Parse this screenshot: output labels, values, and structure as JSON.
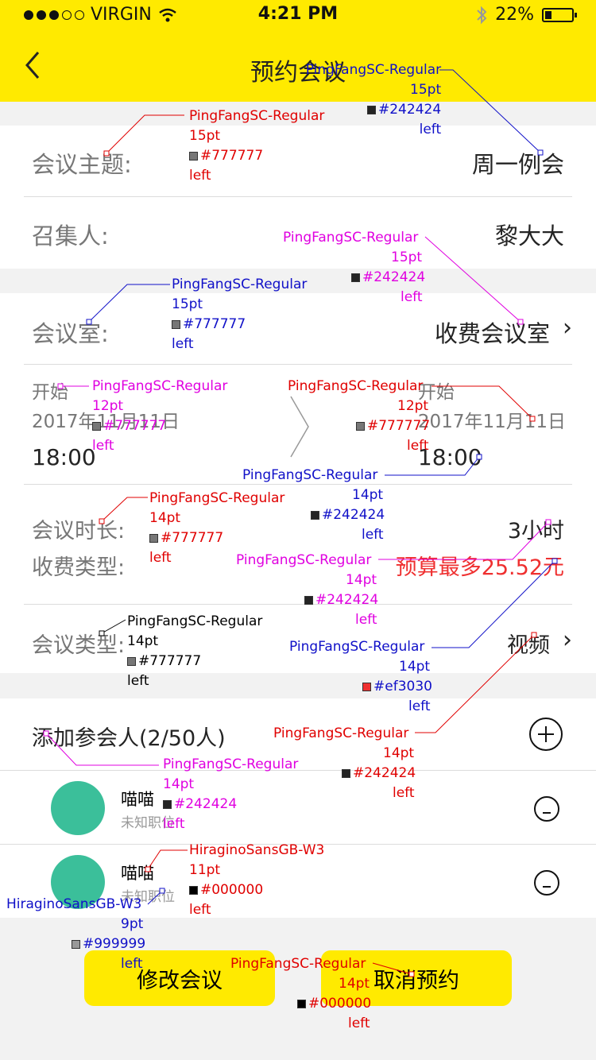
{
  "status": {
    "carrier": "VIRGIN",
    "time": "4:21 PM",
    "battery": "22%"
  },
  "nav": {
    "title": "预约会议"
  },
  "form": {
    "topic_label": "会议主题:",
    "topic_value": "周一例会",
    "organizer_label": "召集人:",
    "organizer_value": "黎大大",
    "room_label": "会议室:",
    "room_value": "收费会议室",
    "start_label": "开始",
    "start_date": "2017年11月11日",
    "start_time": "18:00",
    "end_label": "开始",
    "end_date": "2017年11月11日",
    "end_time": "18:00",
    "duration_label": "会议时长:",
    "duration_value": "3小时",
    "fee_label": "收费类型:",
    "fee_value": "预算最多25.52元",
    "type_label": "会议类型:",
    "type_value": "视频"
  },
  "participants": {
    "title": "添加参会人(2/50人)",
    "items": [
      {
        "name": "喵喵",
        "position": "未知职位"
      },
      {
        "name": "喵喵",
        "position": "未知职位"
      }
    ]
  },
  "buttons": {
    "modify": "修改会议",
    "cancel": "取消预约"
  },
  "colors": {
    "accent": "#ffea00",
    "label": "#777777",
    "text": "#242424",
    "red": "#ef3030",
    "avatar": "#3bbf9a"
  },
  "annotations": {
    "a1": {
      "font": "PingFangSC-Regular",
      "size": "15pt",
      "color": "#242424",
      "align": "left"
    },
    "a2": {
      "font": "PingFangSC-Regular",
      "size": "15pt",
      "color": "#777777",
      "align": "left"
    },
    "a3": {
      "font": "PingFangSC-Regular",
      "size": "15pt",
      "color": "#242424",
      "align": "left"
    },
    "a4": {
      "font": "PingFangSC-Regular",
      "size": "15pt",
      "color": "#777777",
      "align": "left"
    },
    "a5": {
      "font": "PingFangSC-Regular",
      "size": "12pt",
      "color": "#777777",
      "align": "left"
    },
    "a6": {
      "font": "PingFangSC-Regular",
      "size": "12pt",
      "color": "#777777",
      "align": "left"
    },
    "a7": {
      "font": "PingFangSC-Regular",
      "size": "14pt",
      "color": "#242424",
      "align": "left"
    },
    "a8": {
      "font": "PingFangSC-Regular",
      "size": "14pt",
      "color": "#777777",
      "align": "left"
    },
    "a9": {
      "font": "PingFangSC-Regular",
      "size": "14pt",
      "color": "#242424",
      "align": "left"
    },
    "a10": {
      "font": "PingFangSC-Regular",
      "size": "14pt",
      "color": "#777777",
      "align": "left"
    },
    "a11": {
      "font": "PingFangSC-Regular",
      "size": "14pt",
      "color": "#ef3030",
      "align": "left"
    },
    "a12": {
      "font": "PingFangSC-Regular",
      "size": "14pt",
      "color": "#242424",
      "align": "left"
    },
    "a13": {
      "font": "PingFangSC-Regular",
      "size": "14pt",
      "color": "#242424",
      "align": "left"
    },
    "a14": {
      "font": "HiraginoSansGB-W3",
      "size": "11pt",
      "color": "#000000",
      "align": "left"
    },
    "a15": {
      "font": "HiraginoSansGB-W3",
      "size": "9pt",
      "color": "#999999",
      "align": "left"
    },
    "a16": {
      "font": "PingFangSC-Regular",
      "size": "14pt",
      "color": "#000000",
      "align": "left"
    }
  }
}
